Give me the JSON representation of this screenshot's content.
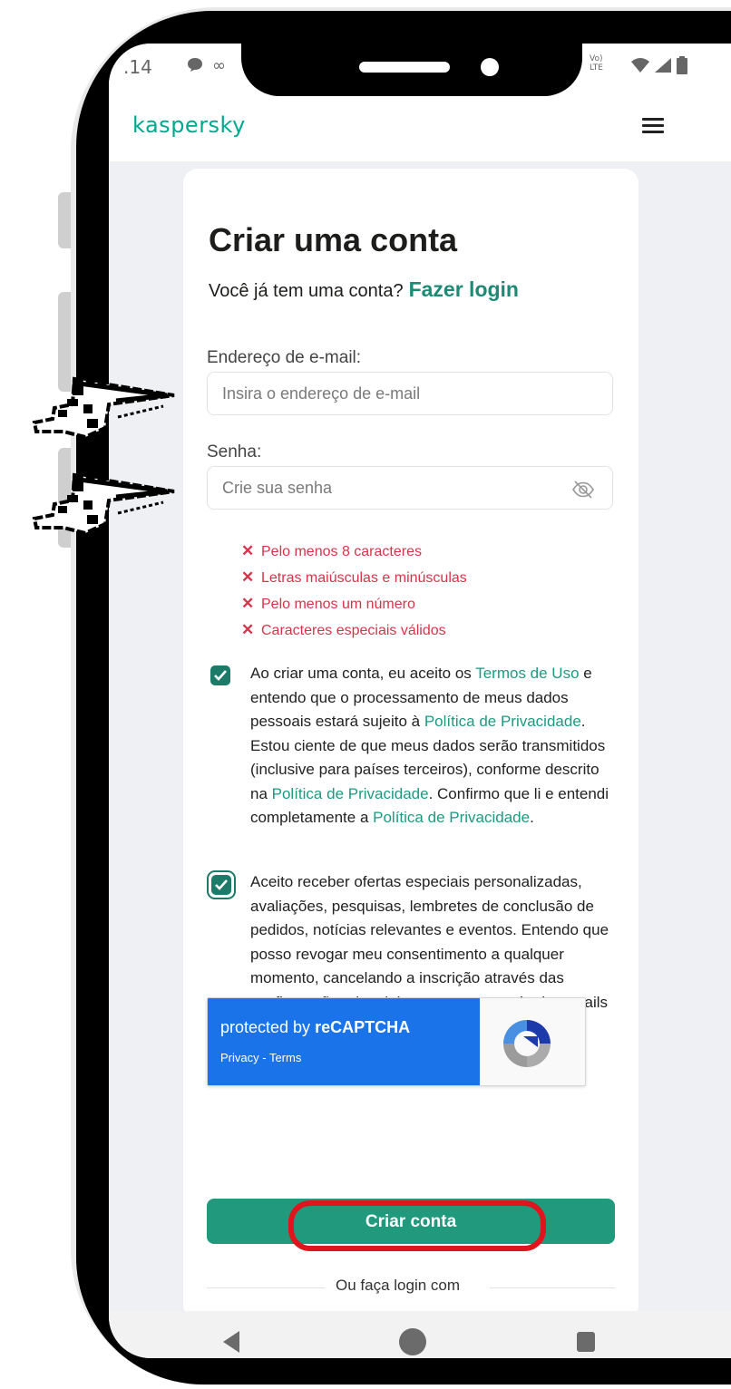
{
  "status_bar": {
    "time": ".14",
    "left_icons": [
      "chat-icon",
      "infinity-icon"
    ],
    "right_icons": [
      "volte-icon",
      "wifi-icon",
      "signal-icon",
      "battery-icon"
    ],
    "volte_text": "Vo) LTE"
  },
  "header": {
    "logo": "kaspersky",
    "menu_icon": "hamburger-icon"
  },
  "form": {
    "title": "Criar uma conta",
    "login_prompt": "Você já tem uma conta?",
    "login_link": "Fazer login",
    "email_label": "Endereço de e-mail:",
    "email_placeholder": "Insira o endereço de e-mail",
    "password_label": "Senha:",
    "password_placeholder": "Crie sua senha",
    "password_rules": [
      "Pelo menos 8 caracteres",
      "Letras maiúsculas e minúsculas",
      "Pelo menos um número",
      "Caracteres especiais válidos"
    ],
    "rule_icon": "✕",
    "rule_color": "#d9334a"
  },
  "consent_terms": {
    "checked": true,
    "text_1": "Ao criar uma conta, eu aceito os ",
    "link_terms": "Termos de Uso",
    "text_2": " e entendo que o processamento de meus dados pessoais estará sujeito à ",
    "link_privacy_1": "Política de Privacidade",
    "text_3": ". Estou ciente de que meus dados serão transmitidos (inclusive para países terceiros), conforme descrito na ",
    "link_privacy_2": "Política de Privacidade",
    "text_4": ". Confirmo que li e entendi completamente a ",
    "link_privacy_3": "Política de Privacidade",
    "text_5": "."
  },
  "consent_marketing": {
    "checked": true,
    "text": "Aceito receber ofertas especiais personalizadas, avaliações, pesquisas, lembretes de conclusão de pedidos, notícias relevantes e eventos. Entendo que posso revogar meu consentimento a qualquer momento, cancelando a inscrição através das configurações da minha conta ou através de e-mails similares."
  },
  "recaptcha": {
    "title_prefix": "protected by ",
    "title_brand": "reCAPTCHA",
    "privacy": "Privacy",
    "separator": " - ",
    "terms": "Terms"
  },
  "actions": {
    "create_button": "Criar conta",
    "alt_login": "Ou faça login com"
  },
  "colors": {
    "brand": "#00a88e",
    "accent": "#21997c",
    "link": "#1d9a80",
    "highlight": "#e0141c",
    "recaptcha_blue": "#1a73e8"
  }
}
